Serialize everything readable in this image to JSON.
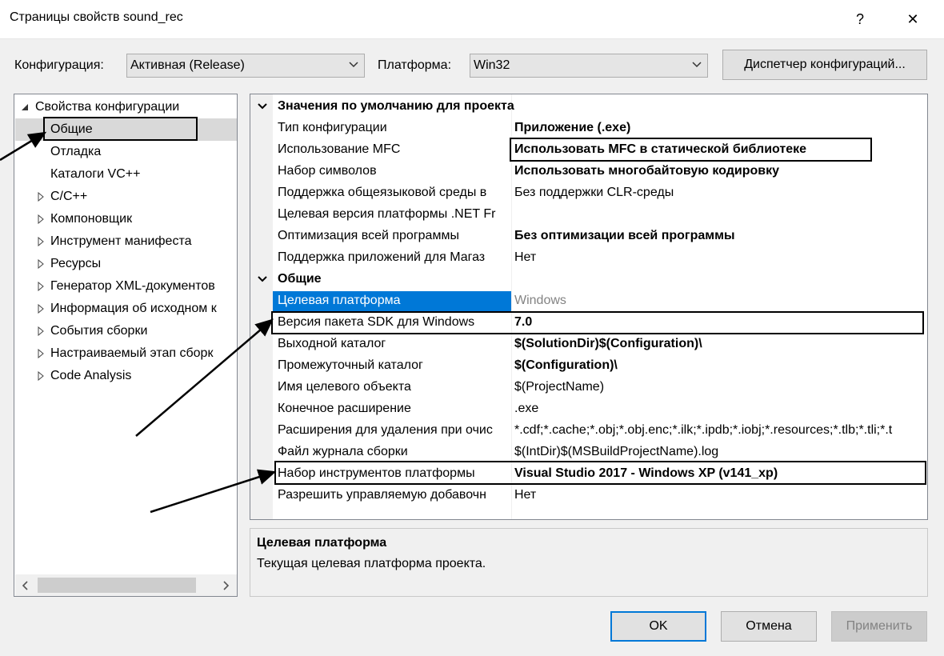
{
  "window": {
    "title": "Страницы свойств sound_rec",
    "help": "?",
    "close": "✕"
  },
  "toolbar": {
    "config_label": "Конфигурация:",
    "config_value": "Активная (Release)",
    "platform_label": "Платформа:",
    "platform_value": "Win32",
    "config_manager": "Диспетчер конфигураций..."
  },
  "tree": {
    "root": "Свойства конфигурации",
    "items": [
      "Общие",
      "Отладка",
      "Каталоги VC++",
      "C/C++",
      "Компоновщик",
      "Инструмент манифеста",
      "Ресурсы",
      "Генератор XML-документов",
      "Информация об исходном к",
      "События сборки",
      "Настраиваемый этап сборк",
      "Code Analysis"
    ]
  },
  "grid": {
    "cat1": "Значения по умолчанию для проекта",
    "rows1": [
      {
        "name": "Тип конфигурации",
        "value": "Приложение (.exe)"
      },
      {
        "name": "Использование MFC",
        "value": "Использовать MFC в статической библиотеке"
      },
      {
        "name": "Набор символов",
        "value": "Использовать многобайтовую кодировку"
      },
      {
        "name": "Поддержка общеязыковой среды в",
        "value": "Без поддержки CLR-среды"
      },
      {
        "name": "Целевая версия платформы .NET Fr",
        "value": ""
      },
      {
        "name": "Оптимизация всей программы",
        "value": "Без оптимизации всей программы"
      },
      {
        "name": "Поддержка приложений для Магаз",
        "value": "Нет"
      }
    ],
    "cat2": "Общие",
    "rows2": [
      {
        "name": "Целевая платформа",
        "value": "Windows"
      },
      {
        "name": "Версия пакета SDK для Windows",
        "value": "7.0"
      },
      {
        "name": "Выходной каталог",
        "value": "$(SolutionDir)$(Configuration)\\"
      },
      {
        "name": "Промежуточный каталог",
        "value": "$(Configuration)\\"
      },
      {
        "name": "Имя целевого объекта",
        "value": "$(ProjectName)"
      },
      {
        "name": "Конечное расширение",
        "value": ".exe"
      },
      {
        "name": "Расширения для удаления при очис",
        "value": "*.cdf;*.cache;*.obj;*.obj.enc;*.ilk;*.ipdb;*.iobj;*.resources;*.tlb;*.tli;*.t"
      },
      {
        "name": "Файл журнала сборки",
        "value": "$(IntDir)$(MSBuildProjectName).log"
      },
      {
        "name": "Набор инструментов платформы",
        "value": "Visual Studio 2017 - Windows XP (v141_xp)"
      },
      {
        "name": "Разрешить управляемую добавочн",
        "value": "Нет"
      }
    ]
  },
  "description": {
    "title": "Целевая платформа",
    "text": "Текущая целевая платформа проекта."
  },
  "buttons": {
    "ok": "OK",
    "cancel": "Отмена",
    "apply": "Применить"
  },
  "colors": {
    "selection": "#0078d7",
    "tree_selection": "#d9d9d9",
    "disabled_text": "#838383"
  }
}
